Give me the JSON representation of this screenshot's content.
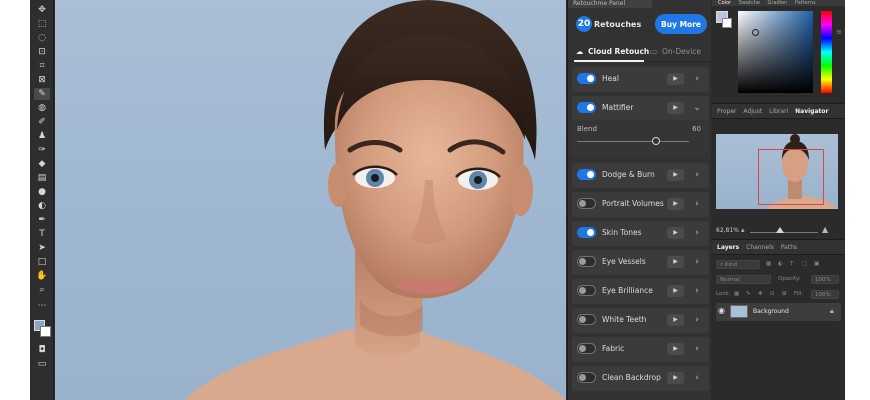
{
  "toolbar": {
    "tools": [
      "move-icon",
      "marquee-icon",
      "lasso-icon",
      "object-select-icon",
      "crop-icon",
      "frame-icon",
      "eyedropper-icon",
      "spot-heal-icon",
      "brush-icon",
      "stamp-icon",
      "history-brush-icon",
      "eraser-icon",
      "gradient-icon",
      "blur-icon",
      "dodge-icon",
      "pen-icon",
      "type-icon",
      "path-select-icon",
      "rectangle-icon",
      "hand-icon",
      "zoom-icon",
      "more-icon"
    ],
    "foreground_color": "#8ea6c4",
    "background_color": "#ffffff"
  },
  "retouch": {
    "panel_title": "Retouchme Panel",
    "count": "20",
    "count_label": "Retouches",
    "buy_label": "Buy More",
    "mode_cloud": "Cloud Retouch",
    "mode_device": "On-Device",
    "blend_label": "Blend",
    "blend_value": "60",
    "blend_fraction": 0.6,
    "features": [
      {
        "label": "Heal",
        "on": true
      },
      {
        "label": "Mattifier",
        "on": true
      },
      {
        "label": "Dodge & Burn",
        "on": true
      },
      {
        "label": "Portrait Volumes",
        "on": false
      },
      {
        "label": "Skin Tones",
        "on": true
      },
      {
        "label": "Eye Vessels",
        "on": false
      },
      {
        "label": "Eye Brilliance",
        "on": false
      },
      {
        "label": "White Teeth",
        "on": false
      },
      {
        "label": "Fabric",
        "on": false
      },
      {
        "label": "Clean Backdrop",
        "on": false
      }
    ],
    "accent": "#1f78e5"
  },
  "dock": {
    "color_tabs": [
      "Color",
      "Swatche",
      "Gradien",
      "Patterns"
    ],
    "nav_tabs": [
      "Proper",
      "Adjust",
      "Librari",
      "Navigator"
    ],
    "zoom_value": "62,81%",
    "layers_tabs": [
      "Layers",
      "Channels",
      "Paths"
    ],
    "layer_kind": "Kind",
    "blend_mode": "Normal",
    "opacity_label": "Opacity:",
    "opacity_value": "100%",
    "lock_label": "Lock:",
    "fill_label": "Fill:",
    "fill_value": "100%",
    "layer_name": "Background"
  }
}
